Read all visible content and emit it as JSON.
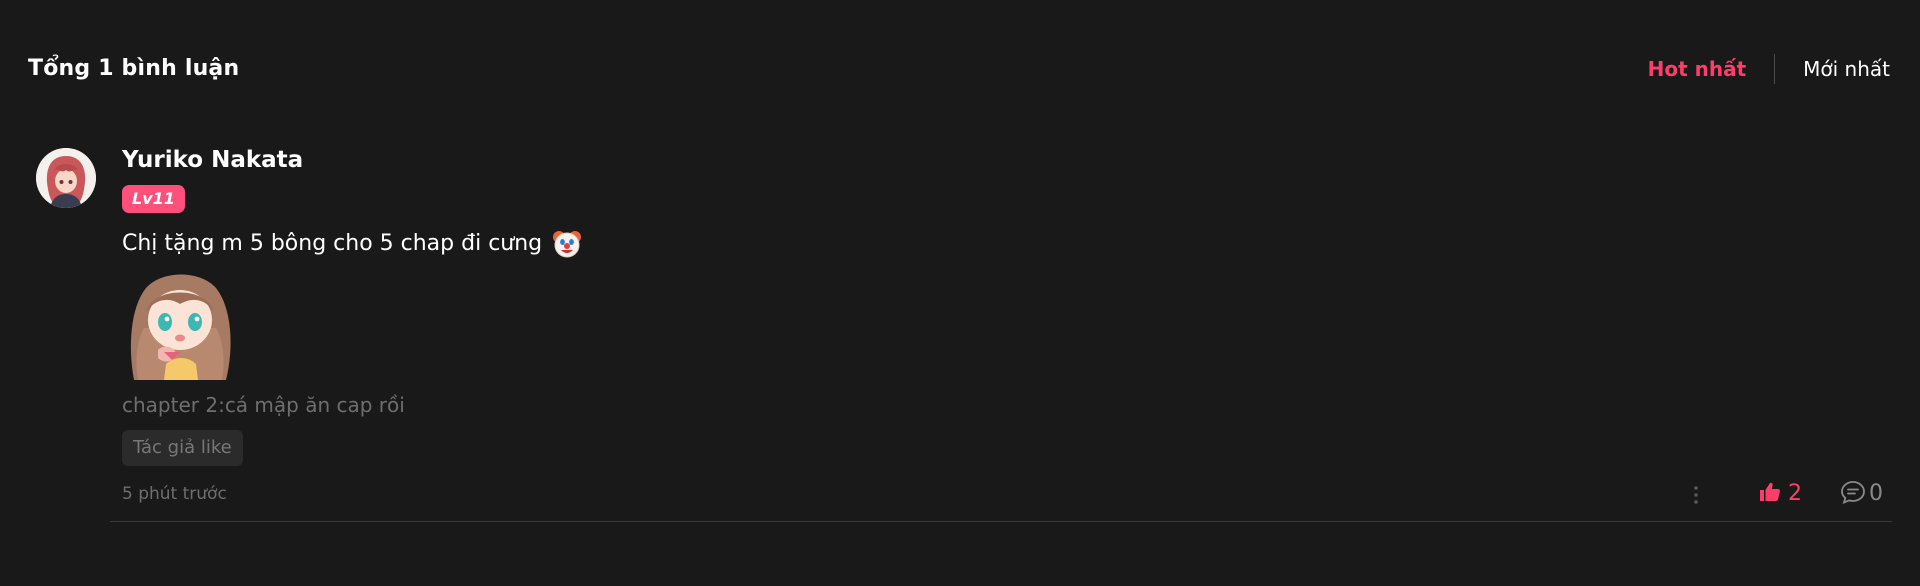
{
  "header": {
    "title": "Tổng 1 bình luận",
    "sort_tabs": [
      {
        "label": "Hot nhất",
        "active": true
      },
      {
        "label": "Mới nhất",
        "active": false
      }
    ]
  },
  "comment": {
    "username": "Yuriko Nakata",
    "level": "Lv11",
    "text": "Chị tặng m 5 bông cho 5 chap đi cưng",
    "emoji": "clown-face-icon",
    "sticker": "anime-girl-sticker",
    "chapter_ref": "chapter 2:cá mập ăn cap rồi",
    "tag": "Tác giả like",
    "timestamp": "5 phút trước",
    "likes": "2",
    "replies": "0"
  },
  "colors": {
    "background": "#1a191a",
    "accent": "#ff3d6b",
    "level_badge": "#ff4f7a",
    "muted_text": "#6e6e6e",
    "tag_background": "#2b2b2b"
  }
}
